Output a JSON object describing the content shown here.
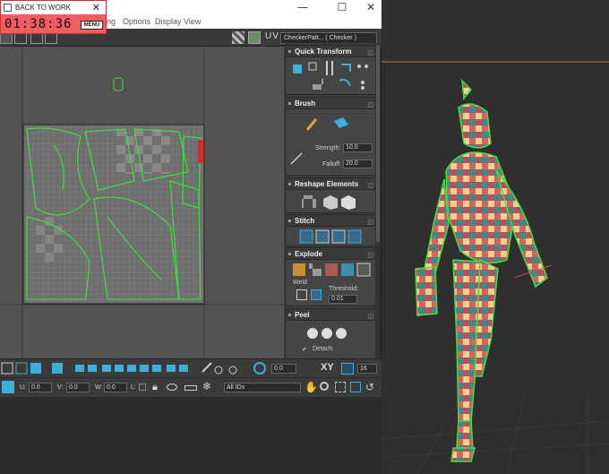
{
  "timer": {
    "title": "BACK TO WORK",
    "time": "01:38:36",
    "menu_label": "MENU",
    "close_glyph": "✕"
  },
  "editor": {
    "menus": [
      "ing",
      "Options",
      "Display",
      "View"
    ],
    "window_controls": [
      "—",
      "☐",
      "✕"
    ],
    "uv_label": "UV",
    "checker_select": "CheckerPatt... ( Checker )"
  },
  "panel": {
    "quick_transform": "Quick Transform",
    "brush": "Brush",
    "strength_label": "Strength:",
    "strength_value": "10.0",
    "falloff_label": "Falloff:",
    "falloff_value": "20.0",
    "reshape": "Reshape Elements",
    "stitch": "Stitch",
    "explode": "Explode",
    "weld_label": "Weld",
    "threshold_label": "Threshold:",
    "threshold_value": "0.01",
    "peel": "Peel",
    "detach_label": "Detach"
  },
  "bottom": {
    "angle_value": "0.0",
    "xy_label": "XY",
    "grid_value": "16",
    "u_label": "U:",
    "u_value": "0.0",
    "v_label": "V:",
    "v_value": "0.0",
    "w_label": "W:",
    "w_value": "0.0",
    "l_label": "L:",
    "ids_select": "All IDs"
  },
  "colors": {
    "timer_bg": "#f25d63",
    "selection_green": "#3ee03e",
    "uv_canvas": "#535353",
    "panel_bg": "#454545",
    "accent_cyan": "#3bb0d8"
  }
}
